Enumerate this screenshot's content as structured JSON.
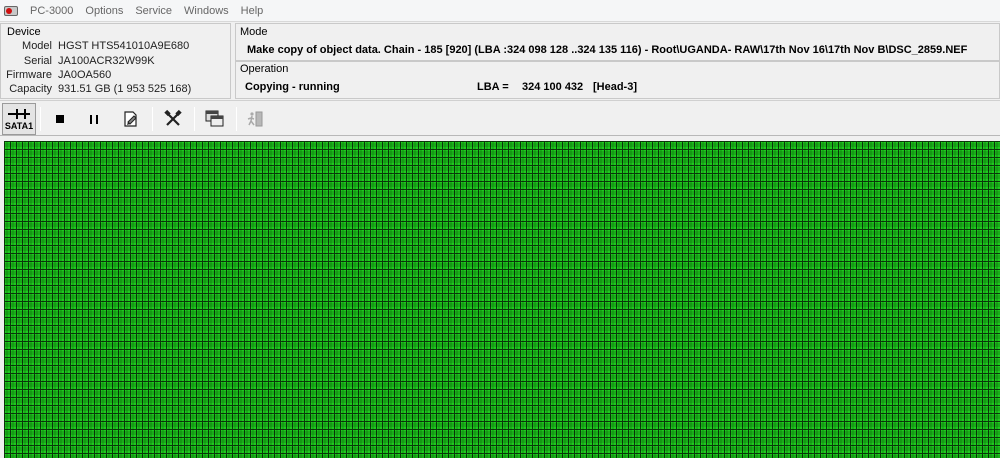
{
  "menu": {
    "title": "PC-3000",
    "items": [
      "Options",
      "Service",
      "Windows",
      "Help"
    ]
  },
  "device": {
    "legend": "Device",
    "model_label": "Model",
    "model": "HGST HTS541010A9E680",
    "serial_label": "Serial",
    "serial": "JA100ACR32W99K",
    "firmware_label": "Firmware",
    "firmware": "JA0OA560",
    "capacity_label": "Capacity",
    "capacity": "931.51 GB (1 953 525 168)"
  },
  "mode": {
    "legend": "Mode",
    "text": "Make copy of object data. Chain - 185 [920] (LBA :324 098 128 ..324 135 116) - Root\\UGANDA- RAW\\17th Nov 16\\17th Nov B\\DSC_2859.NEF"
  },
  "operation": {
    "legend": "Operation",
    "status": "Copying - running",
    "lba_label": "LBA =",
    "lba_value": "324 100 432",
    "head": "[Head-3]"
  },
  "toolbar": {
    "sata_label": "SATA1",
    "icons": [
      "sata-connector-icon",
      "stop-icon",
      "pause-icon",
      "document-edit-icon",
      "tools-icon",
      "windows-icon",
      "exit-icon"
    ]
  },
  "sector_map": {
    "cell_color": "#22c922",
    "border_color": "#0b3a0b",
    "status": "all-read-ok"
  }
}
